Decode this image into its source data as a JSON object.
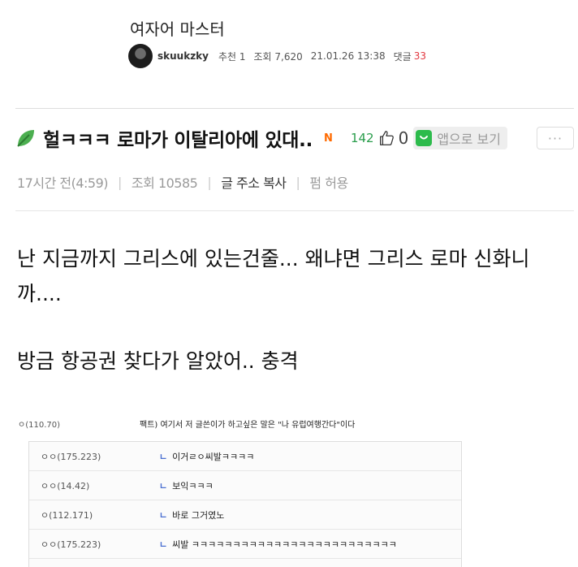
{
  "outer": {
    "title": "여자어 마스터",
    "user": "skuukzky",
    "recommend": "추천 1",
    "views": "조회 7,620",
    "datetime": "21.01.26 13:38",
    "comments_label": "댓글",
    "comments_count": "33"
  },
  "post": {
    "title": "헐ㅋㅋㅋ 로마가 이탈리아에 있대..",
    "new_badge": "N",
    "likes": "142",
    "dislikes": "0",
    "app_button": "앱으로 보기",
    "more_button": "···"
  },
  "info": {
    "time": "17시간 전(4:59)",
    "views": "조회 10585",
    "copy_url": "글 주소 복사",
    "repost": "펌 허용"
  },
  "body": {
    "para1": "난 지금까지 그리스에 있는건줄... 왜냐면 그리스 로마 신화니까....",
    "para2": "방금 항공권 찾다가 알았어.. 충격"
  },
  "comments": {
    "top": {
      "ip": "ㅇ(110.70)",
      "text": "팩트) 여기서 저 글쓴이가 하고싶은 말은 \"나 유럽여행간다\"이다"
    },
    "reply_arrow": "ㄴ",
    "replies": [
      {
        "ip": "ㅇㅇ(175.223)",
        "text": "이거ㄹㅇ씨발ㅋㅋㅋㅋ"
      },
      {
        "ip": "ㅇㅇ(14.42)",
        "text": "보익ㅋㅋㅋ"
      },
      {
        "ip": "ㅇ(112.171)",
        "text": "바로 그거였노"
      },
      {
        "ip": "ㅇㅇ(175.223)",
        "text": "씨발 ㅋㅋㅋㅋㅋㅋㅋㅋㅋㅋㅋㅋㅋㅋㅋㅋㅋㅋㅋㅋㅋㅋㅋㅋㅋ"
      }
    ]
  },
  "colors": {
    "accent_green": "#2dbb4c",
    "comment_count_red": "#e2373f",
    "new_badge_orange": "#ff6a00"
  }
}
